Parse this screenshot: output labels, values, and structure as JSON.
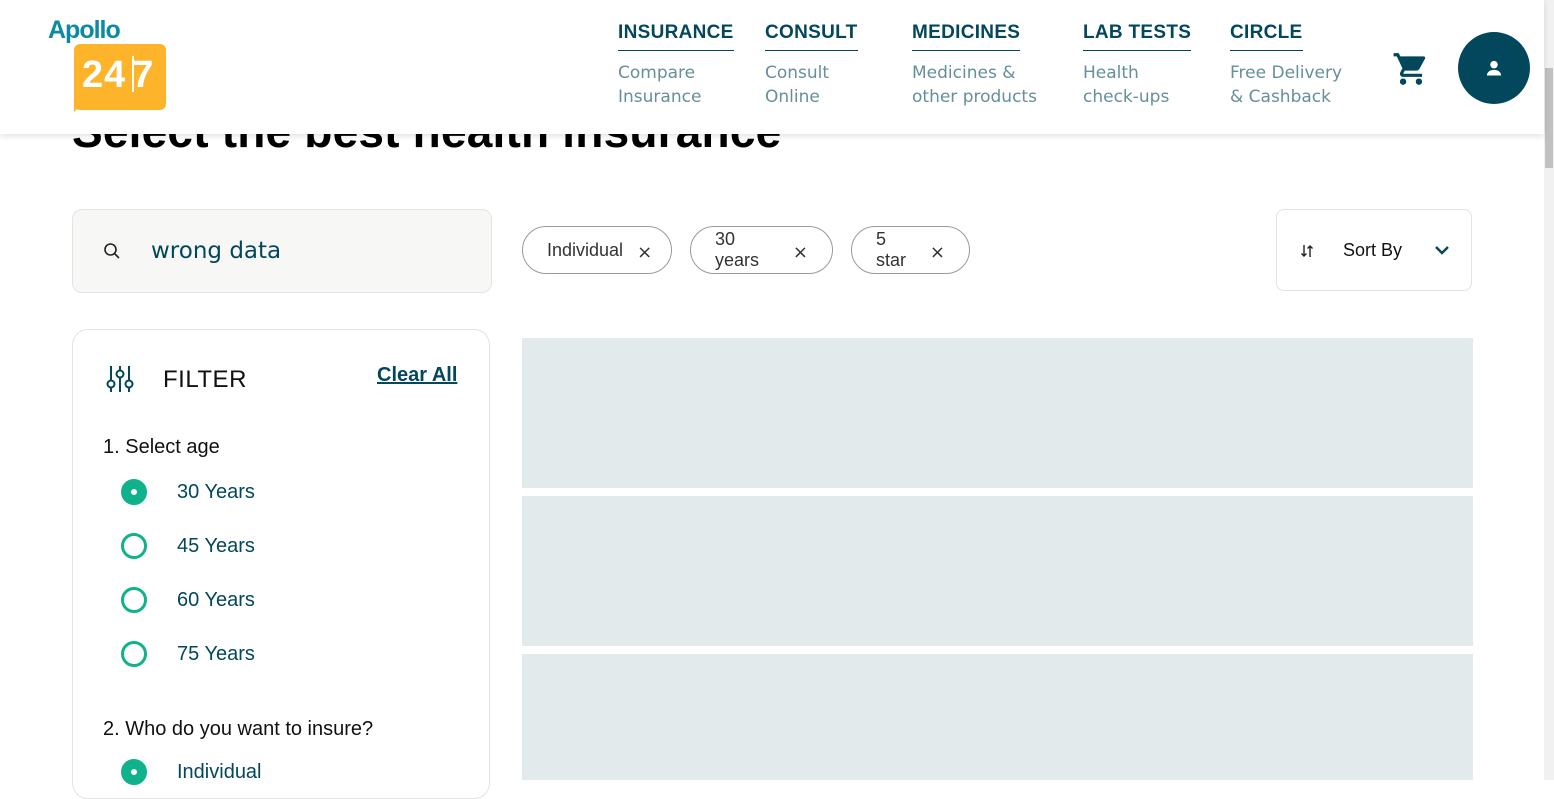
{
  "page": {
    "title": "Select the best health insurance"
  },
  "header": {
    "logo": {
      "top": "Apollo",
      "number": "24",
      "number2": "7"
    },
    "nav": [
      {
        "title": "INSURANCE",
        "subtitle": "Compare Insurance"
      },
      {
        "title": "CONSULT",
        "subtitle": "Consult Online"
      },
      {
        "title": "MEDICINES",
        "subtitle": "Medicines & other products"
      },
      {
        "title": "LAB TESTS",
        "subtitle": "Health check-ups"
      },
      {
        "title": "CIRCLE",
        "subtitle": "Free Delivery & Cashback"
      }
    ],
    "cart_icon": "shopping-cart-icon",
    "profile_icon": "user-icon"
  },
  "search": {
    "value": "wrong data",
    "icon": "search-icon"
  },
  "chips": [
    {
      "label": "Individual",
      "remove": "×"
    },
    {
      "label": "30 years",
      "remove": "×"
    },
    {
      "label": "5 star",
      "remove": "×"
    }
  ],
  "sort": {
    "label": "Sort By",
    "icon": "sort-arrows-icon",
    "chevron": "chevron-down-icon"
  },
  "filter": {
    "title": "FILTER",
    "clear_all": "Clear All",
    "icon": "sliders-icon",
    "sections": [
      {
        "title": "1. Select age",
        "options": [
          {
            "label": "30 Years",
            "selected": true
          },
          {
            "label": "45 Years",
            "selected": false
          },
          {
            "label": "60 Years",
            "selected": false
          },
          {
            "label": "75 Years",
            "selected": false
          }
        ]
      },
      {
        "title": "2. Who do you want to insure?",
        "options": [
          {
            "label": "Individual",
            "selected": true
          }
        ]
      }
    ]
  },
  "colors": {
    "brand_dark": "#02475b",
    "brand_teal": "#10b28b",
    "logo_yellow": "#fdb42b",
    "logo_blue": "#0c8aa4",
    "skeleton": "#e3eaec"
  }
}
